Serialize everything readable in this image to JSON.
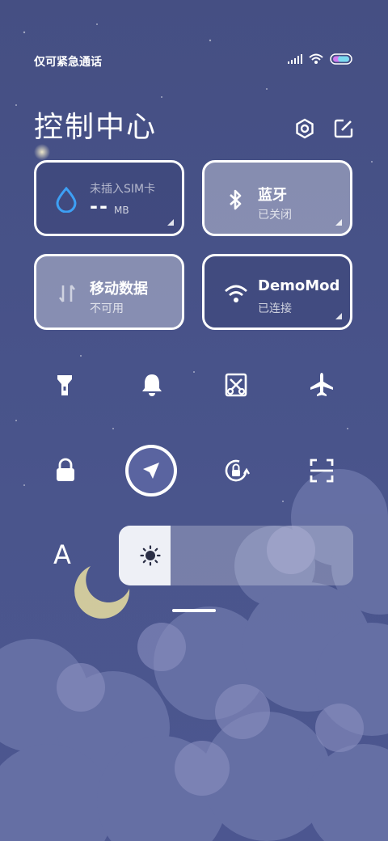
{
  "status": {
    "carrier_text": "仅可紧急通话"
  },
  "header": {
    "title": "控制中心"
  },
  "cards": {
    "data_usage": {
      "top_text": "未插入SIM卡",
      "value": "--",
      "unit": "MB"
    },
    "bluetooth": {
      "label": "蓝牙",
      "status": "已关闭"
    },
    "mobile_data": {
      "label": "移动数据",
      "status": "不可用"
    },
    "wifi": {
      "label": "DemoMod",
      "status": "已连接"
    }
  },
  "quick_toggles_row1": [
    "flashlight-icon",
    "bell-icon",
    "screenshot-icon",
    "airplane-icon"
  ],
  "quick_toggles_row2": [
    "lock-icon",
    "location-icon",
    "rotation-lock-icon",
    "scan-icon"
  ],
  "font_button_label": "A",
  "brightness": {
    "level": 0.22
  },
  "colors": {
    "accent_blue": "#3da0f5",
    "background": "#48538a"
  }
}
